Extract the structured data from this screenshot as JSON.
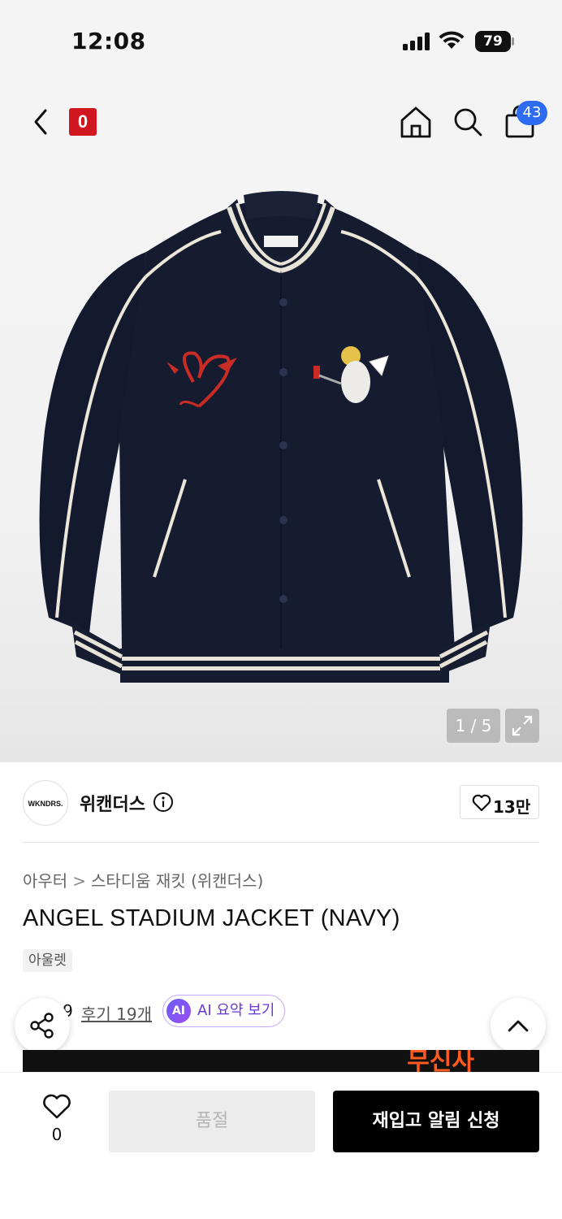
{
  "status_bar": {
    "time": "12:08",
    "battery": "79"
  },
  "header": {
    "logo_text": "0",
    "cart_count": "43"
  },
  "gallery": {
    "counter": "1 / 5"
  },
  "brand": {
    "avatar_text": "WKNDRS.",
    "name": "위캔더스",
    "like_count": "13만"
  },
  "product": {
    "breadcrumb": [
      "아우터",
      "스타디움 재킷 (위캔더스)"
    ],
    "breadcrumb_sep": ">",
    "title": "ANGEL STADIUM JACKET (NAVY)",
    "tag": "아울렛",
    "rating": "4.9",
    "reviews": "후기 19개",
    "ai_badge": "AI",
    "ai_label": "AI 요약 보기",
    "banner_brand": "무신사"
  },
  "bottom_bar": {
    "wish_count": "0",
    "soldout_label": "품절",
    "restock_label": "재입고 알림 신청"
  },
  "colors": {
    "brand_red": "#d0161e",
    "badge_blue": "#2d6bf0",
    "ai_purple": "#6a37d8",
    "navy": "#141a2e"
  }
}
